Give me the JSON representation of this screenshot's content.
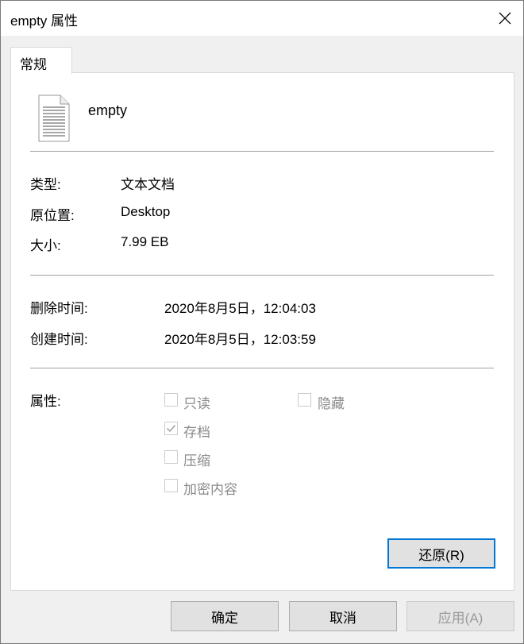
{
  "window": {
    "title": "empty 属性"
  },
  "tabs": [
    {
      "label": "常规",
      "active": true
    }
  ],
  "file": {
    "name": "empty",
    "icon": "text-document-icon"
  },
  "info": {
    "type_label": "类型:",
    "type_value": "文本文档",
    "location_label": "原位置:",
    "location_value": "Desktop",
    "size_label": "大小:",
    "size_value": "7.99 EB",
    "deleted_label": "删除时间:",
    "deleted_value": "2020年8月5日，12:04:03",
    "created_label": "创建时间:",
    "created_value": "2020年8月5日，12:03:59",
    "attributes_label": "属性:"
  },
  "attributes": {
    "readonly": {
      "label": "只读",
      "checked": false
    },
    "hidden": {
      "label": "隐藏",
      "checked": false
    },
    "archive": {
      "label": "存档",
      "checked": true
    },
    "compress": {
      "label": "压缩",
      "checked": false
    },
    "encrypt": {
      "label": "加密内容",
      "checked": false
    }
  },
  "buttons": {
    "restore": "还原(R)",
    "ok": "确定",
    "cancel": "取消",
    "apply": "应用(A)"
  },
  "colors": {
    "focus_border": "#0078d7",
    "disabled_text": "#8a8a8a"
  }
}
